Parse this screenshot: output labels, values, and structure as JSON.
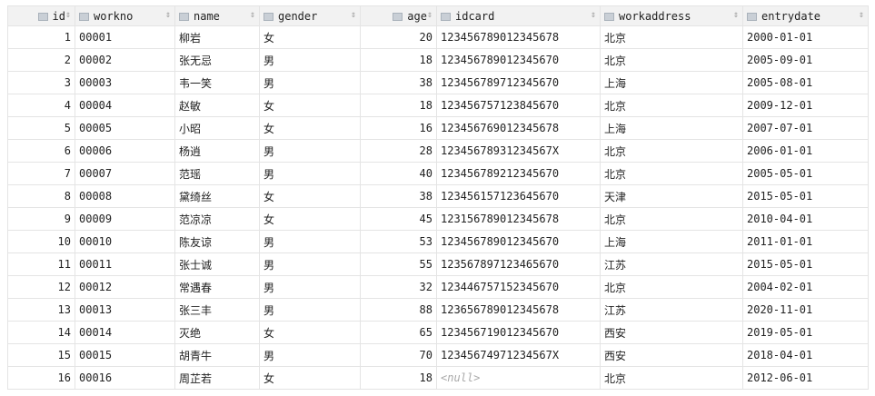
{
  "columns": [
    "id",
    "workno",
    "name",
    "gender",
    "age",
    "idcard",
    "workaddress",
    "entrydate"
  ],
  "rows": [
    [
      "1",
      "00001",
      "柳岩",
      "女",
      "20",
      "123456789012345678",
      "北京",
      "2000-01-01"
    ],
    [
      "2",
      "00002",
      "张无忌",
      "男",
      "18",
      "123456789012345670",
      "北京",
      "2005-09-01"
    ],
    [
      "3",
      "00003",
      "韦一笑",
      "男",
      "38",
      "123456789712345670",
      "上海",
      "2005-08-01"
    ],
    [
      "4",
      "00004",
      "赵敏",
      "女",
      "18",
      "123456757123845670",
      "北京",
      "2009-12-01"
    ],
    [
      "5",
      "00005",
      "小昭",
      "女",
      "16",
      "123456769012345678",
      "上海",
      "2007-07-01"
    ],
    [
      "6",
      "00006",
      "杨逍",
      "男",
      "28",
      "12345678931234567X",
      "北京",
      "2006-01-01"
    ],
    [
      "7",
      "00007",
      "范瑶",
      "男",
      "40",
      "123456789212345670",
      "北京",
      "2005-05-01"
    ],
    [
      "8",
      "00008",
      "黛绮丝",
      "女",
      "38",
      "123456157123645670",
      "天津",
      "2015-05-01"
    ],
    [
      "9",
      "00009",
      "范凉凉",
      "女",
      "45",
      "123156789012345678",
      "北京",
      "2010-04-01"
    ],
    [
      "10",
      "00010",
      "陈友谅",
      "男",
      "53",
      "123456789012345670",
      "上海",
      "2011-01-01"
    ],
    [
      "11",
      "00011",
      "张士诚",
      "男",
      "55",
      "123567897123465670",
      "江苏",
      "2015-05-01"
    ],
    [
      "12",
      "00012",
      "常遇春",
      "男",
      "32",
      "123446757152345670",
      "北京",
      "2004-02-01"
    ],
    [
      "13",
      "00013",
      "张三丰",
      "男",
      "88",
      "123656789012345678",
      "江苏",
      "2020-11-01"
    ],
    [
      "14",
      "00014",
      "灭绝",
      "女",
      "65",
      "123456719012345670",
      "西安",
      "2019-05-01"
    ],
    [
      "15",
      "00015",
      "胡青牛",
      "男",
      "70",
      "12345674971234567X",
      "西安",
      "2018-04-01"
    ],
    [
      "16",
      "00016",
      "周芷若",
      "女",
      "18",
      "<null>",
      "北京",
      "2012-06-01"
    ]
  ]
}
